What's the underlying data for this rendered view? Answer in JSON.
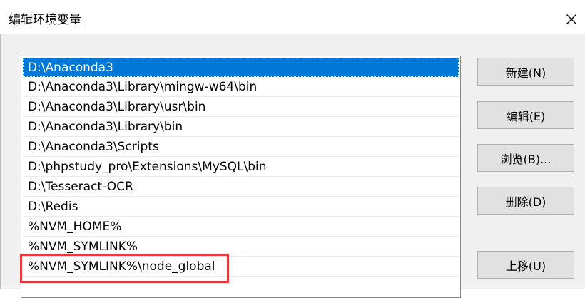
{
  "window": {
    "title": "编辑环境变量",
    "close_glyph": "✕"
  },
  "path_list": {
    "items": [
      "D:\\Anaconda3",
      "D:\\Anaconda3\\Library\\mingw-w64\\bin",
      "D:\\Anaconda3\\Library\\usr\\bin",
      "D:\\Anaconda3\\Library\\bin",
      "D:\\Anaconda3\\Scripts",
      "D:\\phpstudy_pro\\Extensions\\MySQL\\bin",
      "D:\\Tesseract-OCR",
      "D:\\Redis",
      "%NVM_HOME%",
      "%NVM_SYMLINK%",
      "%NVM_SYMLINK%\\node_global"
    ],
    "selected_index": 0,
    "highlighted_index": 10,
    "highlight_color": "#e8383a",
    "selection_color": "#0078d7"
  },
  "buttons": {
    "new": "新建(N)",
    "edit": "编辑(E)",
    "browse": "浏览(B)...",
    "delete": "删除(D)",
    "move_up": "上移(U)"
  }
}
